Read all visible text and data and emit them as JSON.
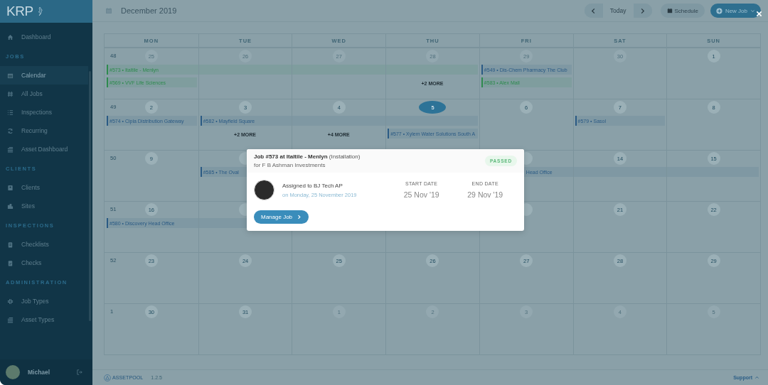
{
  "sidebar": {
    "logo": "KRP",
    "groups": [
      {
        "items": [
          {
            "label": "Dashboard",
            "selected": false
          }
        ]
      },
      {
        "heading": "JOBS",
        "items": [
          {
            "label": "Calendar",
            "selected": true
          },
          {
            "label": "All Jobs",
            "selected": false
          },
          {
            "label": "Inspections",
            "selected": false
          },
          {
            "label": "Recurring",
            "selected": false
          },
          {
            "label": "Asset Dashboard",
            "selected": false
          }
        ]
      },
      {
        "heading": "CLIENTS",
        "items": [
          {
            "label": "Clients",
            "selected": false
          },
          {
            "label": "Sites",
            "selected": false
          }
        ]
      },
      {
        "heading": "INSPECTIONS",
        "items": [
          {
            "label": "Checklists",
            "selected": false
          },
          {
            "label": "Checks",
            "selected": false
          }
        ]
      },
      {
        "heading": "ADMINISTRATION",
        "items": [
          {
            "label": "Job Types",
            "selected": false
          },
          {
            "label": "Asset Types",
            "selected": false
          }
        ]
      }
    ],
    "user": {
      "name": "Michael"
    }
  },
  "toolbar": {
    "title": "December 2019",
    "today": "Today",
    "schedule": "Schedule",
    "new_job": "New Job"
  },
  "calendar": {
    "weekdays": [
      "MON",
      "TUE",
      "WED",
      "THU",
      "FRI",
      "SAT",
      "SUN"
    ],
    "weeks": [
      {
        "week_number": "48",
        "days": [
          {
            "number": "25",
            "muted": true,
            "today": false,
            "entries": [
              {
                "kind": "event",
                "label": "#573 • Italtile - Menlyn",
                "color": "#2e8a4e"
              },
              {
                "kind": "event",
                "label": "#569 • VVF Life Sciences",
                "color": "#2e8a4e"
              }
            ]
          },
          {
            "number": "26",
            "muted": true,
            "today": false,
            "entries": [
              {
                "kind": "continued"
              }
            ]
          },
          {
            "number": "27",
            "muted": true,
            "today": false,
            "entries": [
              {
                "kind": "continued"
              }
            ]
          },
          {
            "number": "28",
            "muted": true,
            "today": false,
            "entries": [
              {
                "kind": "continued"
              },
              {
                "kind": "more",
                "label": "+2 MORE"
              }
            ]
          },
          {
            "number": "29",
            "muted": true,
            "today": false,
            "entries": [
              {
                "kind": "event",
                "label": "#549 • Dis-Chem Pharmacy The Club",
                "color": "#2a5a84"
              },
              {
                "kind": "event",
                "label": "#583 • Alex Mall",
                "color": "#2e8a4e"
              }
            ]
          },
          {
            "number": "30",
            "muted": true,
            "today": false
          },
          {
            "number": "1",
            "muted": false,
            "today": false
          }
        ]
      },
      {
        "week_number": "49",
        "days": [
          {
            "number": "2",
            "muted": false,
            "today": false,
            "entries": [
              {
                "kind": "event",
                "label": "#574 • Cipla Distribution Gateway",
                "color": "#2a5a84"
              }
            ]
          },
          {
            "number": "3",
            "muted": false,
            "today": false,
            "entries": [
              {
                "kind": "event",
                "label": "#582 • Mayfield Square",
                "color": "#2a5a84"
              },
              {
                "kind": "more",
                "label": "+2 MORE"
              }
            ]
          },
          {
            "number": "4",
            "muted": false,
            "today": false,
            "entries": [
              {
                "kind": "continued"
              },
              {
                "kind": "more",
                "label": "+4 MORE"
              }
            ]
          },
          {
            "number": "5",
            "muted": false,
            "today": true,
            "entries": [
              {
                "kind": "continued"
              },
              {
                "kind": "event",
                "label": "#577 • Xylem Water Solutions South A",
                "color": "#2a5a84"
              }
            ]
          },
          {
            "number": "6",
            "muted": false,
            "today": false
          },
          {
            "number": "7",
            "muted": false,
            "today": false,
            "entries": [
              {
                "kind": "event",
                "label": "#579 • Sasol",
                "color": "#2a5a84"
              }
            ]
          },
          {
            "number": "8",
            "muted": false,
            "today": false
          }
        ]
      },
      {
        "week_number": "50",
        "days": [
          {
            "number": "9",
            "muted": false,
            "today": false
          },
          {
            "kind": "covered",
            "entries": [
              {
                "kind": "event",
                "label": "#585 • The Oval",
                "color": "#2a5a84"
              }
            ]
          },
          {
            "kind": "covered"
          },
          {
            "kind": "covered"
          },
          {
            "kind": "covered",
            "entries": [
              {
                "kind": "tail",
                "label": "Head Office"
              }
            ]
          },
          {
            "number": "14",
            "muted": false,
            "today": false,
            "entries": [
              {
                "kind": "continued"
              }
            ]
          },
          {
            "number": "15",
            "muted": false,
            "today": false,
            "entries": [
              {
                "kind": "continued"
              }
            ]
          }
        ]
      },
      {
        "week_number": "51",
        "days": [
          {
            "number": "16",
            "muted": false,
            "today": false,
            "entries": [
              {
                "kind": "event",
                "label": "#580 • Discovery Head Office",
                "color": "#2a5a84"
              }
            ]
          },
          {
            "kind": "covered",
            "entries": [
              {
                "kind": "continued"
              }
            ]
          },
          {
            "kind": "covered"
          },
          {
            "kind": "covered"
          },
          {
            "kind": "covered"
          },
          {
            "number": "21",
            "muted": false,
            "today": false
          },
          {
            "number": "22",
            "muted": false,
            "today": false
          }
        ]
      },
      {
        "week_number": "52",
        "days": [
          {
            "number": "23",
            "muted": false,
            "today": false
          },
          {
            "number": "24",
            "muted": false,
            "today": false
          },
          {
            "number": "25",
            "muted": false,
            "today": false
          },
          {
            "number": "26",
            "muted": false,
            "today": false
          },
          {
            "number": "27",
            "muted": false,
            "today": false
          },
          {
            "number": "28",
            "muted": false,
            "today": false
          },
          {
            "number": "29",
            "muted": false,
            "today": false
          }
        ]
      },
      {
        "week_number": "1",
        "days": [
          {
            "number": "30",
            "muted": false,
            "today": false
          },
          {
            "number": "31",
            "muted": false,
            "today": false
          },
          {
            "number": "1",
            "muted": true,
            "today": false
          },
          {
            "number": "2",
            "muted": true,
            "today": false
          },
          {
            "number": "3",
            "muted": true,
            "today": false
          },
          {
            "number": "4",
            "muted": true,
            "today": false
          },
          {
            "number": "5",
            "muted": true,
            "today": false
          }
        ]
      }
    ]
  },
  "modal": {
    "title": "**Job #573 at Italtile - Menlyn** (Installation)",
    "client": "for F B Ashman Investments",
    "status": "PASSED",
    "assigned": "Assigned to BJ Tech AP",
    "assigned_date": "on Monday, 25 November 2019",
    "start_label": "START DATE",
    "start_date": "25 Nov '19",
    "end_label": "END DATE",
    "end_date": "29 Nov '19",
    "button": "Manage Job"
  },
  "footer": {
    "brand": "ASSETPOOL",
    "version": "1.2.5",
    "support": "Support"
  }
}
